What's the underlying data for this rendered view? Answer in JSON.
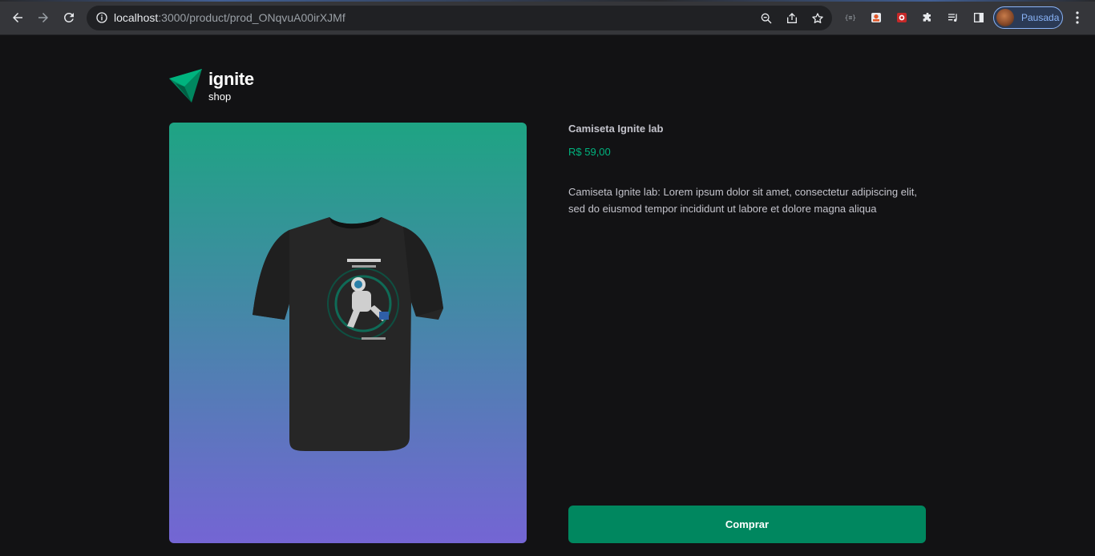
{
  "browser": {
    "url_host": "localhost",
    "url_path": ":3000/product/prod_ONqvuA00irXJMf",
    "profile_name": "Pausada"
  },
  "header": {
    "brand": "ignite",
    "brand_sub": "shop"
  },
  "product": {
    "title": "Camiseta Ignite lab",
    "price": "R$ 59,00",
    "description": "Camiseta Ignite lab: Lorem ipsum dolor sit amet, consectetur adipiscing elit, sed do eiusmod tempor incididunt ut labore et dolore magna aliqua",
    "buy_label": "Comprar",
    "image_semantic": "black-tshirt-astronaut-print"
  },
  "colors": {
    "background": "#121214",
    "accent_green": "#00875f",
    "price_green": "#00b37e",
    "gradient_top": "#1ea483",
    "gradient_bottom": "#7465d4"
  }
}
